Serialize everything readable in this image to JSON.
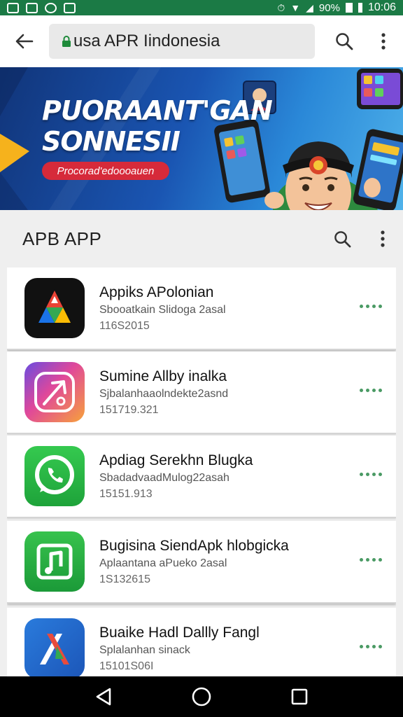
{
  "status_bar": {
    "battery_text": "90%",
    "time": "10:06",
    "icons": [
      "notification-icon",
      "notification-icon",
      "browser-icon",
      "notification-icon",
      "alarm-icon",
      "wifi-icon",
      "signal-icon",
      "battery-icon"
    ]
  },
  "browser": {
    "url": "usa APR Iindonesia",
    "icons": [
      "back-arrow-icon",
      "lock-icon",
      "search-icon",
      "more-vert-icon"
    ]
  },
  "banner": {
    "title_line1": "PUORAANT'GAN",
    "title_line2": "SONNESII",
    "button_label": "Procorad'edoooauen"
  },
  "section": {
    "title": "APB APP",
    "icons": [
      "search-icon",
      "more-vert-icon"
    ]
  },
  "apps": [
    {
      "name": "Appiks APolonian",
      "subtitle": "Sbooatkain Slidoga 2asal",
      "size": "116S2015",
      "icon": "triangle-logo-icon"
    },
    {
      "name": "Sumine Allby inalka",
      "subtitle": "Sjbalanhaaolndekte2asnd",
      "size": "151719.321",
      "icon": "compass-logo-icon"
    },
    {
      "name": "Apdiag Serekhn Blugka",
      "subtitle": "SbadadvaadMulog22asah",
      "size": "15151.913",
      "icon": "phone-chat-icon"
    },
    {
      "name": "Bugisina SiendApk hlobgicka",
      "subtitle": "Aplaantana aPueko 2asal",
      "size": "1S132615",
      "icon": "music-note-icon"
    },
    {
      "name": "Buaike Hadl Dallly Fangl",
      "subtitle": "Splalanhan sinack",
      "size": "15101S06I",
      "icon": "x-logo-icon"
    }
  ],
  "nav": {
    "icons": [
      "back-triangle-icon",
      "home-circle-icon",
      "recents-square-icon"
    ]
  },
  "colors": {
    "status_bar": "#1b7a45",
    "accent_green": "#4a9a64",
    "banner_blue": "#1a55b2",
    "banner_pill": "#d62a3a"
  }
}
